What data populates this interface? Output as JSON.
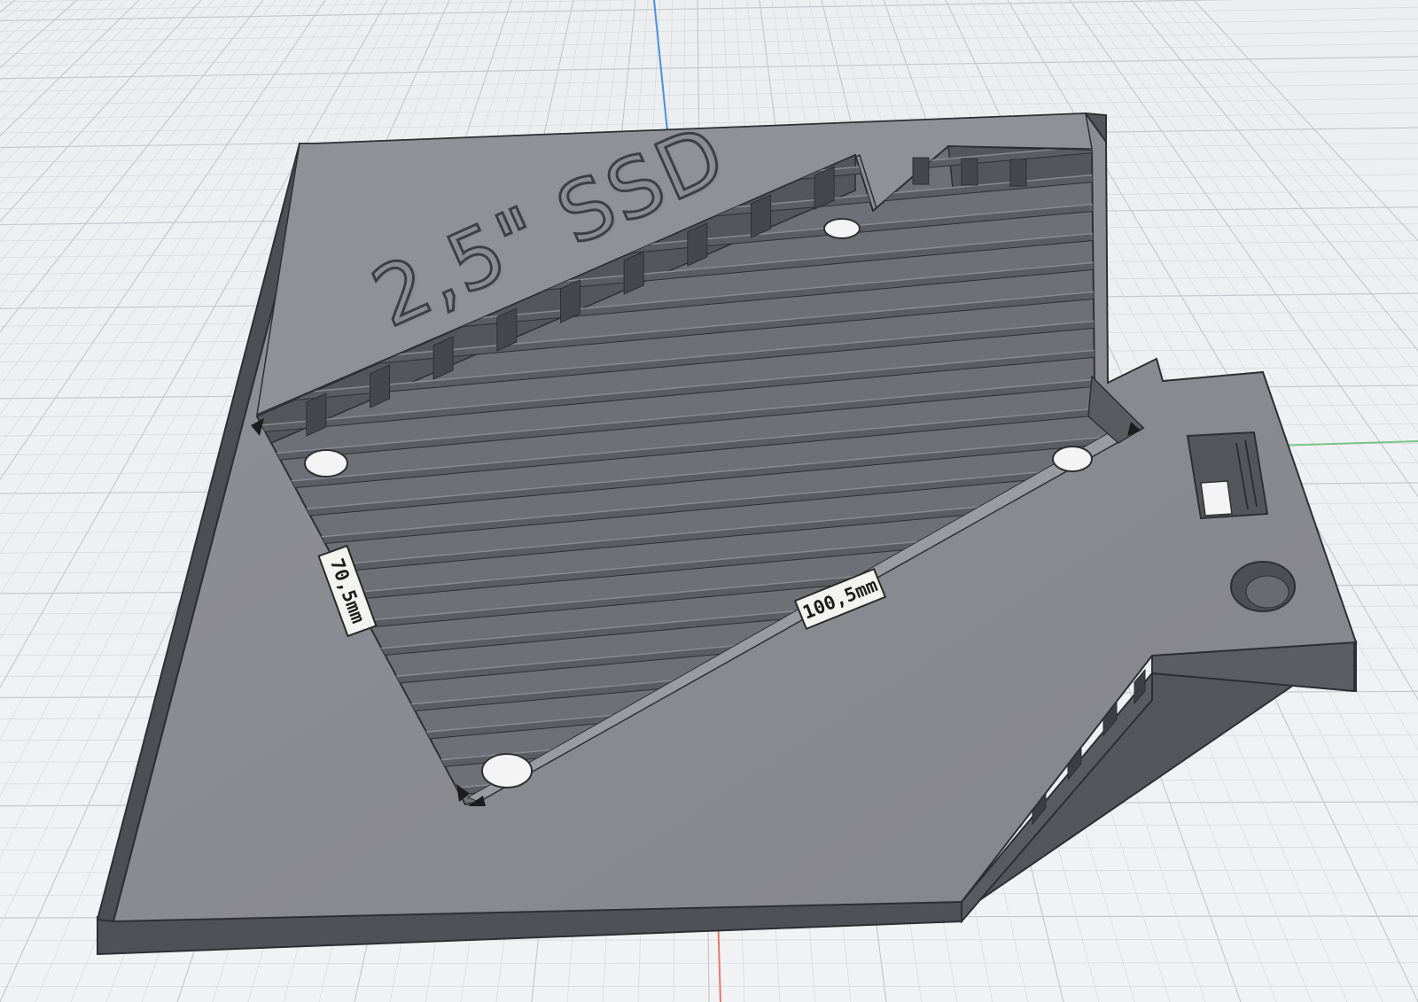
{
  "viewport": {
    "background": "#eef0f2",
    "grid_minor_color": "#d8dbde",
    "grid_major_color": "#c5c9cd",
    "axis_z_color": "#4a8fe0",
    "axis_x_color": "#e07a6a",
    "axis_y_color": "#7ac48a"
  },
  "model": {
    "top_face_color": "#8c8d93",
    "side_face_color": "#5a5b61",
    "pocket_floor_color": "#76777d",
    "edge_color": "#2e2f33",
    "engraved_label": "2,5\" SSD"
  },
  "dimensions": {
    "width_label": "70,5mm",
    "length_label": "100,5mm"
  }
}
